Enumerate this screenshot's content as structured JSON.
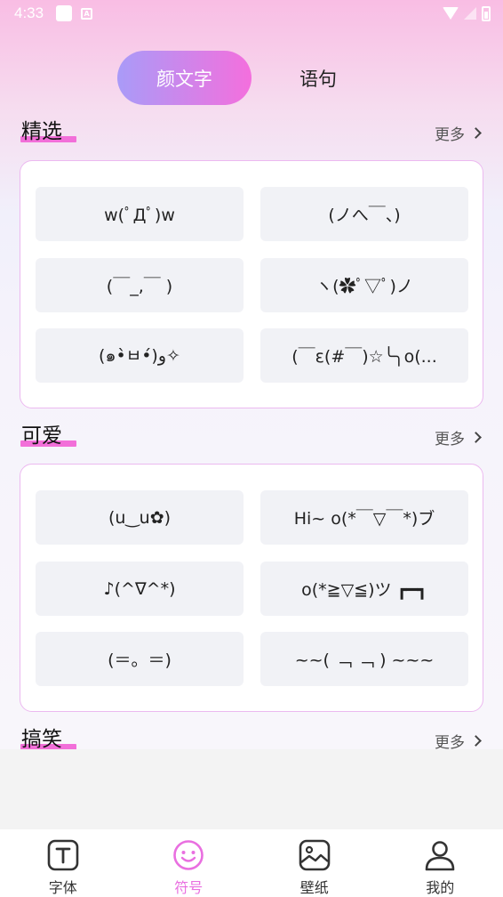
{
  "status": {
    "time": "4:33"
  },
  "tabs": {
    "active": "颜文字",
    "inactive": "语句"
  },
  "more_label": "更多",
  "sections": [
    {
      "title": "精选",
      "items": [
        "w(ﾟДﾟ)w",
        "(ノへ￣、)",
        "(￣_,￣ )",
        "ヽ(✿ﾟ▽ﾟ)ノ",
        "(๑•̀ㅂ•́)و✧",
        "(￣ε(#￣)☆╰╮o(..."
      ]
    },
    {
      "title": "可爱",
      "items": [
        "(u‿u✿)",
        "Hi~ o(*￣▽￣*)ブ",
        "♪(^∇^*)",
        "o(*≧▽≦)ツ ┏━┓",
        "(＝。＝)",
        "~~( ﹁ ﹁ ) ~~~"
      ]
    },
    {
      "title": "搞笑"
    }
  ],
  "nav": [
    {
      "label": "字体",
      "icon": "font-icon"
    },
    {
      "label": "符号",
      "icon": "smiley-icon"
    },
    {
      "label": "壁纸",
      "icon": "image-icon"
    },
    {
      "label": "我的",
      "icon": "user-icon"
    }
  ],
  "colors": {
    "accent": "#f26fd9",
    "tab_gradient_start": "#a99bf8",
    "tab_gradient_end": "#f46fdd",
    "active_nav": "#e96fe0"
  }
}
